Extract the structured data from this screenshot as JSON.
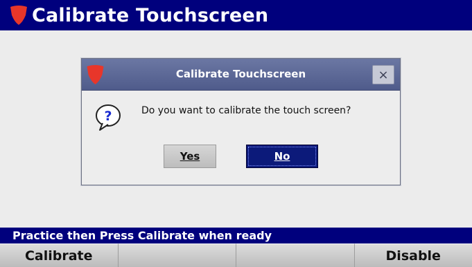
{
  "header": {
    "title": "Calibrate Touchscreen",
    "logo_icon": "shield-logo-icon"
  },
  "dialog": {
    "title": "Calibrate Touchscreen",
    "close_label": "×",
    "message": "Do you want to calibrate the touch screen?",
    "yes_label": "Yes",
    "no_label": "No"
  },
  "status": {
    "text": "Practice then Press Calibrate when ready"
  },
  "softkeys": [
    "Calibrate",
    "",
    "",
    "Disable"
  ],
  "colors": {
    "header_bg": "#00007d",
    "logo_red": "#e8362a",
    "selected_button": "#0c1a7a"
  }
}
